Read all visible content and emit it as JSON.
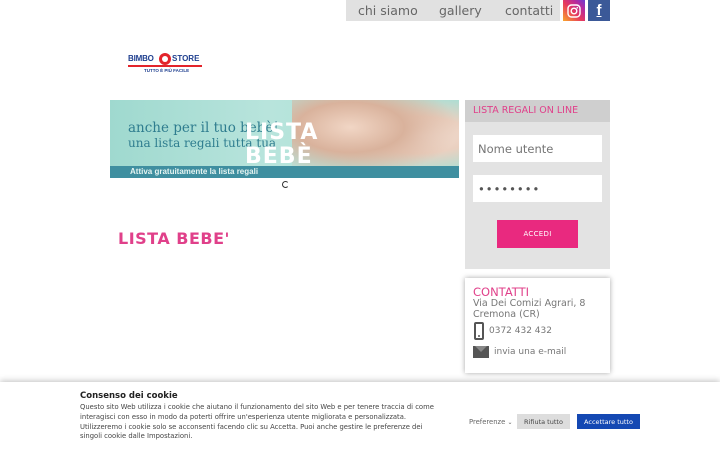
{
  "nav": {
    "items": [
      {
        "label": "chi siamo"
      },
      {
        "label": "gallery"
      },
      {
        "label": "contatti"
      }
    ],
    "social": {
      "instagram_icon": "instagram-icon",
      "facebook_glyph": "f"
    }
  },
  "logo": {
    "part1": "BIMBO",
    "part2": "STORE",
    "tagline": "TUTTO È PIÙ FACILE",
    "colors": {
      "blue": "#1f3f8f",
      "red": "#e3242b"
    }
  },
  "banner": {
    "line1": "anche per il tuo bebè!",
    "line2": "una lista regali tutta tua",
    "big1": "LISTA",
    "big2": "BEBÈ",
    "strip": "Attiva gratuitamente la lista regali"
  },
  "main": {
    "title": "LISTA BEBE'"
  },
  "login": {
    "header": "LISTA REGALI ON LINE",
    "username_placeholder": "Nome utente",
    "password_value": "••••••••",
    "submit": "ACCEDI"
  },
  "contacts": {
    "title": "CONTATTI",
    "address_line1": "Via Dei Comizi Agrari, 8",
    "address_line2": "Cremona (CR)",
    "phone": "0372 432 432",
    "email_link": "invia una e-mail"
  },
  "cookie": {
    "title": "Consenso dei cookie",
    "text": "Questo sito Web utilizza i cookie che aiutano il funzionamento del sito Web e per tenere traccia di come interagisci con esso in modo da poterti offrire un'esperienza utente migliorata e personalizzata. Utilizzeremo i cookie solo se acconsenti facendo clic su Accetta. Puoi anche gestire le preferenze dei singoli cookie dalle Impostazioni.",
    "preferences": "Preferenze",
    "reject": "Rifiuta tutto",
    "accept": "Accettare tutto"
  },
  "colors": {
    "accent_pink": "#e0408a",
    "button_pink": "#e9297f",
    "accept_blue": "#1448b3"
  }
}
